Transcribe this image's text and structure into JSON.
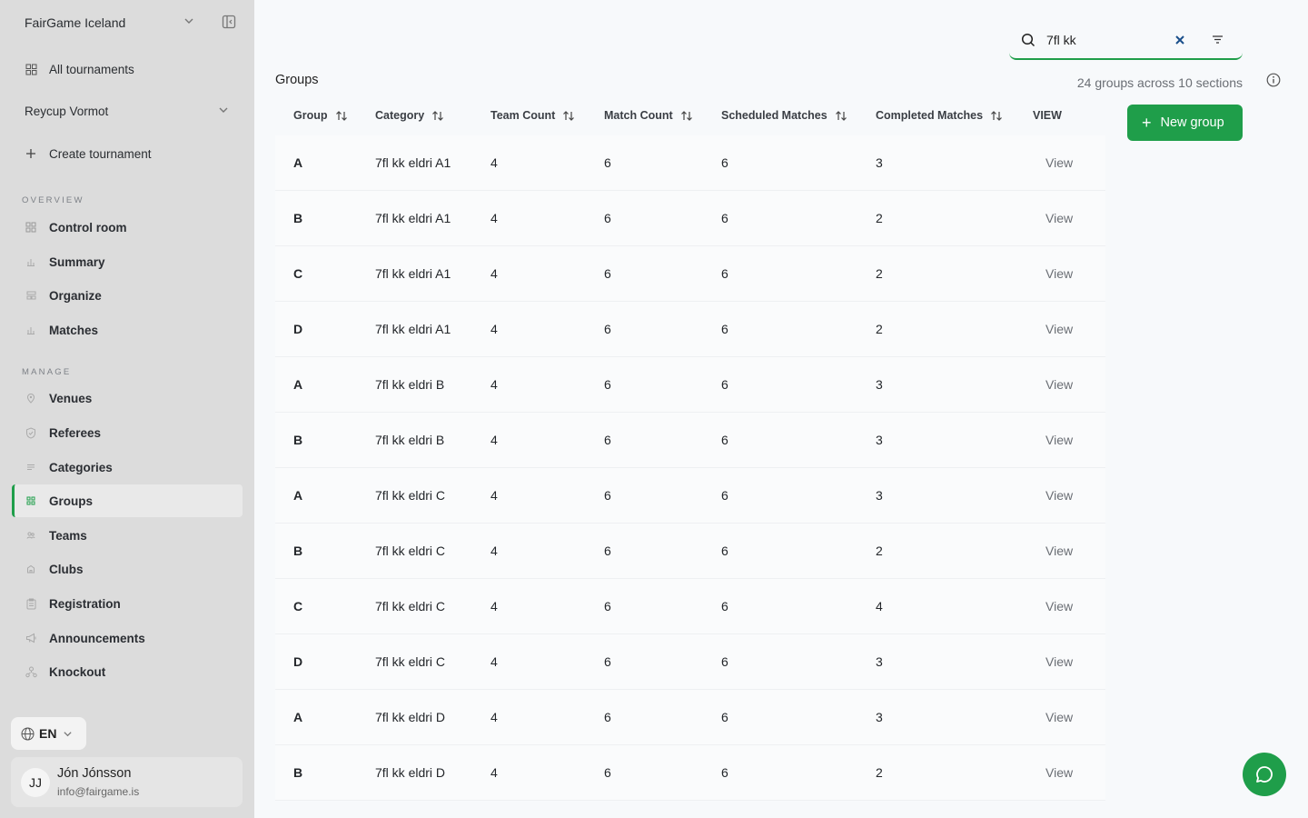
{
  "sidebar": {
    "org_name": "FairGame Iceland",
    "all_tournaments": "All tournaments",
    "tournament_name": "Reycup Vormot",
    "create_tournament": "Create tournament",
    "overview_label": "OVERVIEW",
    "overview_items": [
      {
        "label": "Control room",
        "icon": "grid-icon"
      },
      {
        "label": "Summary",
        "icon": "bar-chart-icon"
      },
      {
        "label": "Organize",
        "icon": "layout-icon"
      },
      {
        "label": "Matches",
        "icon": "bar-chart-icon"
      }
    ],
    "manage_label": "MANAGE",
    "manage_items": [
      {
        "label": "Venues",
        "icon": "map-pin-icon"
      },
      {
        "label": "Referees",
        "icon": "shield-icon"
      },
      {
        "label": "Categories",
        "icon": "list-icon"
      },
      {
        "label": "Groups",
        "icon": "grid-icon"
      },
      {
        "label": "Teams",
        "icon": "users-icon"
      },
      {
        "label": "Clubs",
        "icon": "building-icon"
      },
      {
        "label": "Registration",
        "icon": "clipboard-icon"
      },
      {
        "label": "Announcements",
        "icon": "megaphone-icon"
      },
      {
        "label": "Knockout",
        "icon": "bracket-icon"
      }
    ],
    "language": "EN",
    "user": {
      "initials": "JJ",
      "name": "Jón Jónsson",
      "email": "info@fairgame.is"
    }
  },
  "search": {
    "value": "7fl kk"
  },
  "main": {
    "title": "Groups",
    "summary": "24 groups across 10 sections",
    "new_group_label": "New group"
  },
  "table": {
    "headers": {
      "group": "Group",
      "category": "Category",
      "team_count": "Team Count",
      "match_count": "Match Count",
      "scheduled": "Scheduled Matches",
      "completed": "Completed Matches",
      "view": "VIEW"
    },
    "rows": [
      {
        "group": "A",
        "category": "7fl kk eldri A1",
        "team_count": "4",
        "match_count": "6",
        "scheduled": "6",
        "completed": "3",
        "view": "View"
      },
      {
        "group": "B",
        "category": "7fl kk eldri A1",
        "team_count": "4",
        "match_count": "6",
        "scheduled": "6",
        "completed": "2",
        "view": "View"
      },
      {
        "group": "C",
        "category": "7fl kk eldri A1",
        "team_count": "4",
        "match_count": "6",
        "scheduled": "6",
        "completed": "2",
        "view": "View"
      },
      {
        "group": "D",
        "category": "7fl kk eldri A1",
        "team_count": "4",
        "match_count": "6",
        "scheduled": "6",
        "completed": "2",
        "view": "View"
      },
      {
        "group": "A",
        "category": "7fl kk eldri B",
        "team_count": "4",
        "match_count": "6",
        "scheduled": "6",
        "completed": "3",
        "view": "View"
      },
      {
        "group": "B",
        "category": "7fl kk eldri B",
        "team_count": "4",
        "match_count": "6",
        "scheduled": "6",
        "completed": "3",
        "view": "View"
      },
      {
        "group": "A",
        "category": "7fl kk eldri C",
        "team_count": "4",
        "match_count": "6",
        "scheduled": "6",
        "completed": "3",
        "view": "View"
      },
      {
        "group": "B",
        "category": "7fl kk eldri C",
        "team_count": "4",
        "match_count": "6",
        "scheduled": "6",
        "completed": "2",
        "view": "View"
      },
      {
        "group": "C",
        "category": "7fl kk eldri C",
        "team_count": "4",
        "match_count": "6",
        "scheduled": "6",
        "completed": "4",
        "view": "View"
      },
      {
        "group": "D",
        "category": "7fl kk eldri C",
        "team_count": "4",
        "match_count": "6",
        "scheduled": "6",
        "completed": "3",
        "view": "View"
      },
      {
        "group": "A",
        "category": "7fl kk eldri D",
        "team_count": "4",
        "match_count": "6",
        "scheduled": "6",
        "completed": "3",
        "view": "View"
      },
      {
        "group": "B",
        "category": "7fl kk eldri D",
        "team_count": "4",
        "match_count": "6",
        "scheduled": "6",
        "completed": "2",
        "view": "View"
      }
    ]
  },
  "colors": {
    "accent": "#1f9e4a",
    "sidebar_bg": "#dcdcdc"
  }
}
